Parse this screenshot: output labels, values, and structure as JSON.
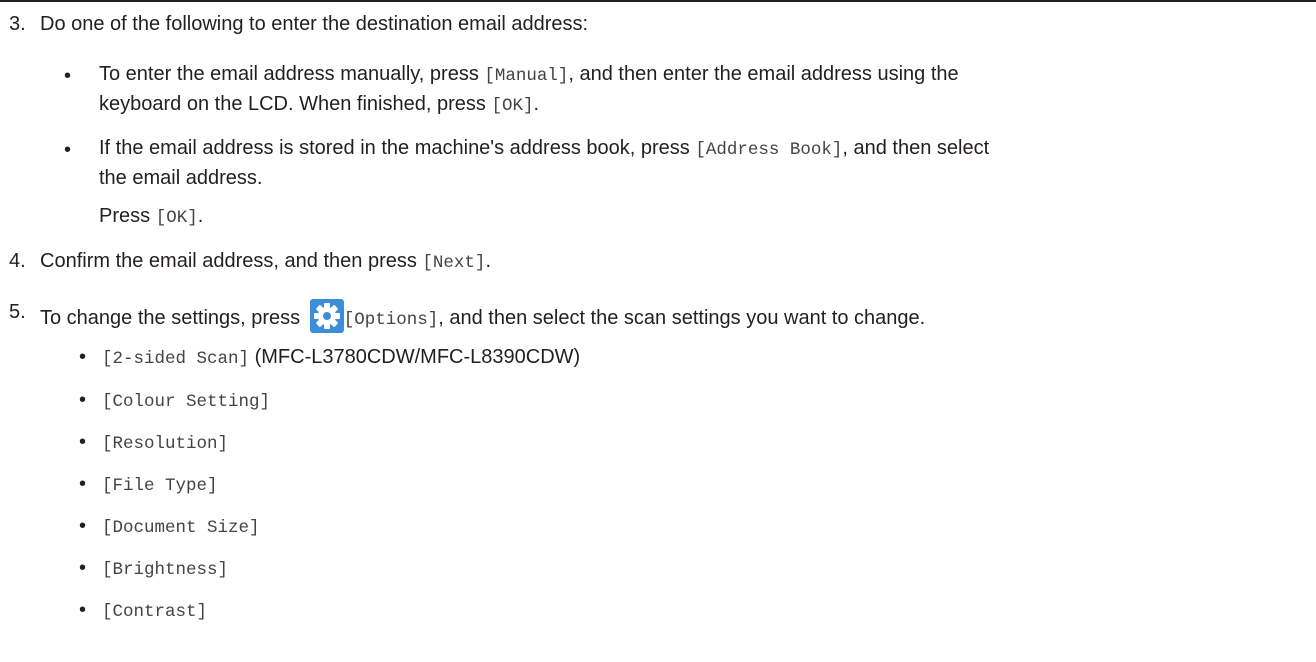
{
  "step3": {
    "number": "3.",
    "text": "Do one of the following to enter the destination email address:",
    "bullet1": {
      "line1_a": "To enter the email address manually, press ",
      "line1_key": "[Manual]",
      "line1_b": ", and then enter the email address using the",
      "line2_a": "keyboard on the LCD. When finished, press ",
      "line2_key": "[OK]",
      "line2_b": "."
    },
    "bullet2": {
      "line1_a": "If the email address is stored in the machine's address book, press ",
      "line1_key": "[Address Book]",
      "line1_b": ", and then select",
      "line2": "the email address.",
      "line3_a": "Press ",
      "line3_key": "[OK]",
      "line3_b": "."
    }
  },
  "step4": {
    "number": "4.",
    "text_a": "Confirm the email address, and then press ",
    "key": "[Next]",
    "text_b": "."
  },
  "step5": {
    "number": "5.",
    "text_a": "To change the settings, press ",
    "icon": "gear-icon",
    "key": "[Options]",
    "text_b": ", and then select the scan settings you want to change.",
    "options": [
      {
        "key": "[2-sided Scan]",
        "note": " (MFC-L3780CDW/MFC-L8390CDW)"
      },
      {
        "key": "[Colour Setting]",
        "note": ""
      },
      {
        "key": "[Resolution]",
        "note": ""
      },
      {
        "key": "[File Type]",
        "note": ""
      },
      {
        "key": "[Document Size]",
        "note": ""
      },
      {
        "key": "[Brightness]",
        "note": ""
      },
      {
        "key": "[Contrast]",
        "note": ""
      }
    ]
  },
  "bullet_glyph": "•",
  "colors": {
    "text": "#231f20",
    "mono": "#444444",
    "icon_bg": "#3d8ed9"
  }
}
